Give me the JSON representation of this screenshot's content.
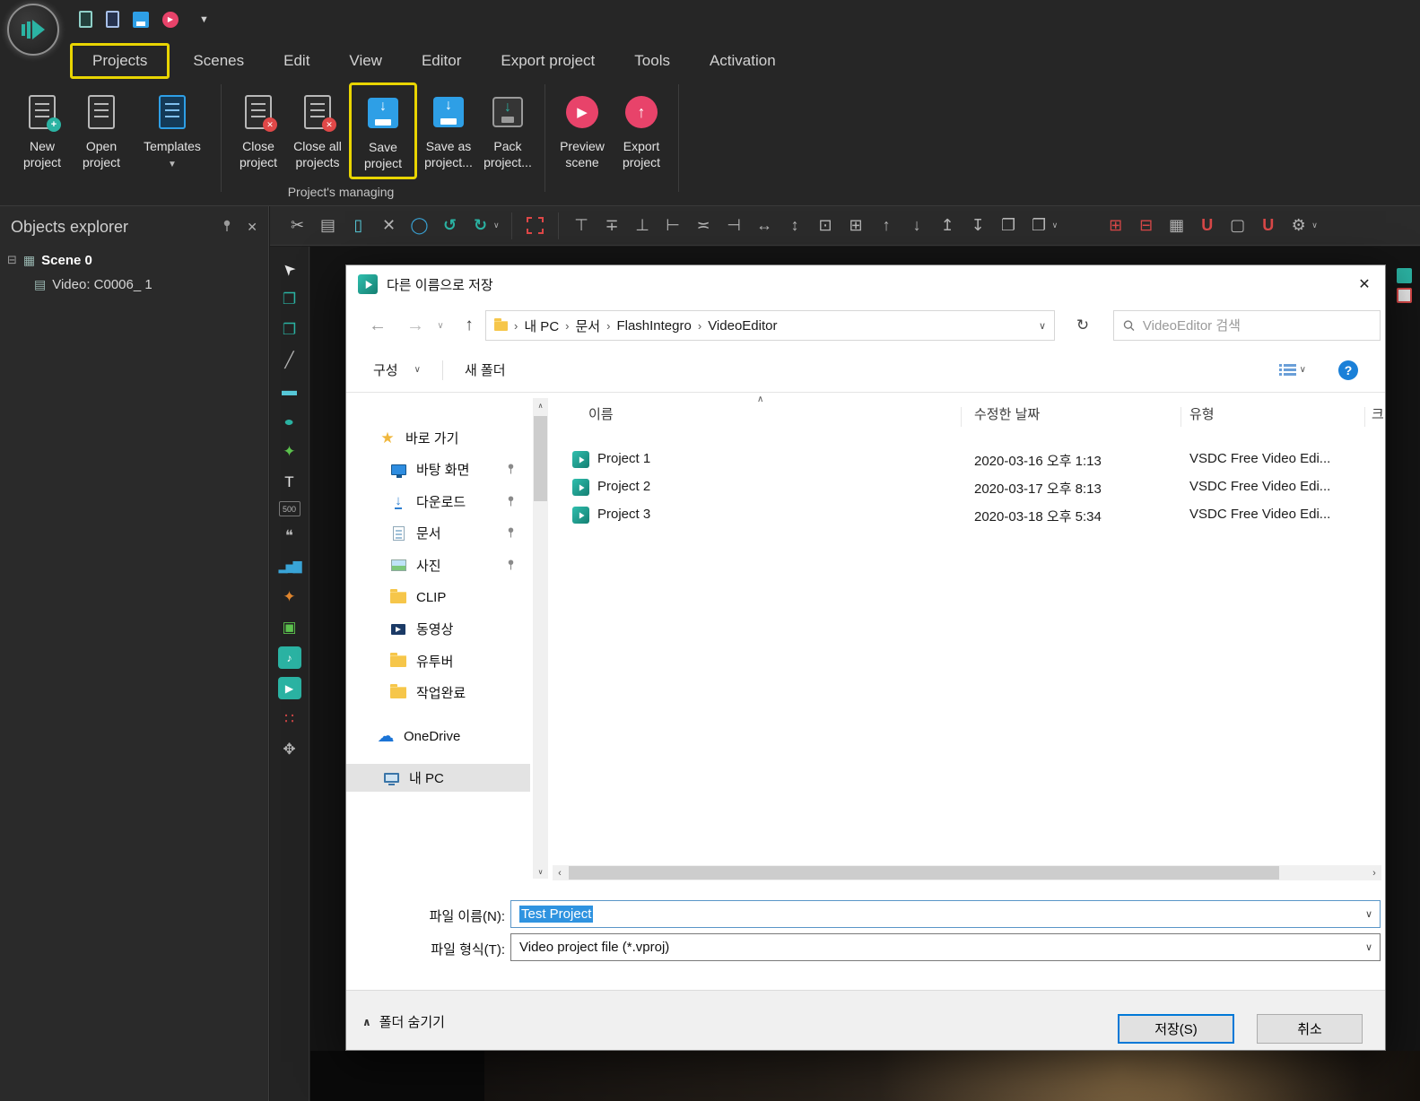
{
  "colors": {
    "accent_teal": "#2bb3a3",
    "accent_pink": "#e8436a",
    "accent_blue": "#2e9fe6",
    "highlight_yellow": "#e9d502",
    "selection_blue": "#2f93e0"
  },
  "glyphs": {
    "caret_down": "▼",
    "chev_down": "∨",
    "chev_up": "∧",
    "chev_left": "‹",
    "chev_right": "›",
    "back": "←",
    "forward": "→",
    "up": "↑",
    "refresh": "↻",
    "close": "✕",
    "help": "?",
    "play": "▶",
    "sort": "∧",
    "expander": "⊟",
    "scene_icon": "▦",
    "video_icon": "▤",
    "star": "★",
    "cloud": "☁",
    "download": "↓"
  },
  "titlebar": {
    "quick_access_icons": [
      "new-project",
      "open-project",
      "save-project",
      "preview-scene"
    ]
  },
  "menu": {
    "items": [
      "Projects",
      "Scenes",
      "Edit",
      "View",
      "Editor",
      "Export project",
      "Tools",
      "Activation"
    ]
  },
  "ribbon": {
    "group_label": "Project's managing",
    "buttons": [
      {
        "name": "new-project",
        "label": "New\nproject"
      },
      {
        "name": "open-project",
        "label": "Open\nproject"
      },
      {
        "name": "templates",
        "label": "Templates"
      },
      {
        "name": "close-project",
        "label": "Close\nproject"
      },
      {
        "name": "close-all-projects",
        "label": "Close all\nprojects"
      },
      {
        "name": "save-project",
        "label": "Save\nproject"
      },
      {
        "name": "save-as-project",
        "label": "Save as\nproject..."
      },
      {
        "name": "pack-project",
        "label": "Pack\nproject..."
      },
      {
        "name": "preview-scene",
        "label": "Preview\nscene"
      },
      {
        "name": "export-project",
        "label": "Export\nproject"
      }
    ]
  },
  "objects_explorer": {
    "title": "Objects explorer",
    "scene_label": "Scene 0",
    "video_label": "Video: C0006_ 1"
  },
  "edit_toolbar": [
    {
      "name": "cut",
      "glyph": "✂"
    },
    {
      "name": "copy",
      "glyph": "▤"
    },
    {
      "name": "paste",
      "glyph": "▯"
    },
    {
      "name": "delete",
      "glyph": "✕"
    },
    {
      "name": "ellipse-select",
      "glyph": "◯"
    },
    {
      "name": "undo",
      "glyph": "↺"
    },
    {
      "name": "redo",
      "glyph": "↻"
    },
    {
      "name": "transform-selection"
    },
    {
      "name": "align-top",
      "glyph": "⊤"
    },
    {
      "name": "align-middle",
      "glyph": "∓"
    },
    {
      "name": "align-bottom",
      "glyph": "⊥"
    },
    {
      "name": "align-left",
      "glyph": "⊢"
    },
    {
      "name": "align-center",
      "glyph": "≍"
    },
    {
      "name": "align-right",
      "glyph": "⊣"
    },
    {
      "name": "same-width",
      "glyph": "↔"
    },
    {
      "name": "same-height",
      "glyph": "↕"
    },
    {
      "name": "same-size",
      "glyph": "⊡"
    },
    {
      "name": "fit-frame",
      "glyph": "⊞"
    },
    {
      "name": "move-up",
      "glyph": "↑"
    },
    {
      "name": "move-down",
      "glyph": "↓"
    },
    {
      "name": "bring-to-front",
      "glyph": "↥"
    },
    {
      "name": "send-to-back",
      "glyph": "↧"
    },
    {
      "name": "group",
      "glyph": "❐"
    },
    {
      "name": "ungroup",
      "glyph": "❐"
    },
    {
      "name": "add-object",
      "glyph": "⊞"
    },
    {
      "name": "add-layer",
      "glyph": "⊟"
    },
    {
      "name": "show-grid",
      "glyph": "▦"
    },
    {
      "name": "snap-lines",
      "glyph": "U"
    },
    {
      "name": "object-bounds",
      "glyph": "▢"
    },
    {
      "name": "underline",
      "glyph": "U"
    },
    {
      "name": "settings",
      "glyph": "⚙"
    }
  ],
  "tools": [
    {
      "name": "pointer-tool",
      "glyph": "➤"
    },
    {
      "name": "layers-tool",
      "glyph": "❐"
    },
    {
      "name": "duplicate-layer-tool",
      "glyph": "❐"
    },
    {
      "name": "line-tool",
      "glyph": "╱"
    },
    {
      "name": "rectangle-tool",
      "glyph": "▬"
    },
    {
      "name": "ellipse-tool",
      "glyph": "●"
    },
    {
      "name": "free-shape-tool",
      "glyph": "✦"
    },
    {
      "name": "text-tool",
      "glyph": "T"
    },
    {
      "name": "counter-tool",
      "glyph": "500"
    },
    {
      "name": "tooltip-tool",
      "glyph": "❝"
    },
    {
      "name": "chart-tool",
      "glyph": "▂▅▇"
    },
    {
      "name": "animation-tool",
      "glyph": "✦"
    },
    {
      "name": "image-tool",
      "glyph": "▣"
    },
    {
      "name": "audio-tool",
      "glyph": "♪"
    },
    {
      "name": "video-tool",
      "glyph": "▶"
    },
    {
      "name": "sprite-tool",
      "glyph": "∷"
    },
    {
      "name": "movement-tool",
      "glyph": "✥"
    }
  ],
  "dlg": {
    "title": "다른 이름으로 저장",
    "nav": {
      "breadcrumb": [
        "내 PC",
        "문서",
        "FlashIntegro",
        "VideoEditor"
      ],
      "search_placeholder": "VideoEditor 검색"
    },
    "commands": {
      "organize": "구성",
      "new_folder": "새 폴더"
    },
    "sidebar": {
      "quick_access": "바로 가기",
      "items": [
        {
          "label": "바탕 화면",
          "pinned": true
        },
        {
          "label": "다운로드",
          "pinned": true
        },
        {
          "label": "문서",
          "pinned": true
        },
        {
          "label": "사진",
          "pinned": true
        },
        {
          "label": "CLIP"
        },
        {
          "label": "동영상"
        },
        {
          "label": "유투버"
        },
        {
          "label": "작업완료"
        }
      ],
      "onedrive": "OneDrive",
      "this_pc": "내 PC"
    },
    "list": {
      "columns": {
        "name": "이름",
        "date": "수정한 날짜",
        "type": "유형",
        "size": "크"
      },
      "files": [
        {
          "name": "Project 1",
          "date": "2020-03-16 오후 1:13",
          "type": "VSDC Free Video Edi..."
        },
        {
          "name": "Project 2",
          "date": "2020-03-17 오후 8:13",
          "type": "VSDC Free Video Edi..."
        },
        {
          "name": "Project 3",
          "date": "2020-03-18 오후 5:34",
          "type": "VSDC Free Video Edi..."
        }
      ]
    },
    "fields": {
      "filename_label": "파일 이름(N):",
      "filename_value": "Test Project",
      "filetype_label": "파일 형식(T):",
      "filetype_value": "Video project file (*.vproj)"
    },
    "footer": {
      "hide_folders": "폴더 숨기기",
      "save": "저장(S)",
      "cancel": "취소"
    }
  }
}
